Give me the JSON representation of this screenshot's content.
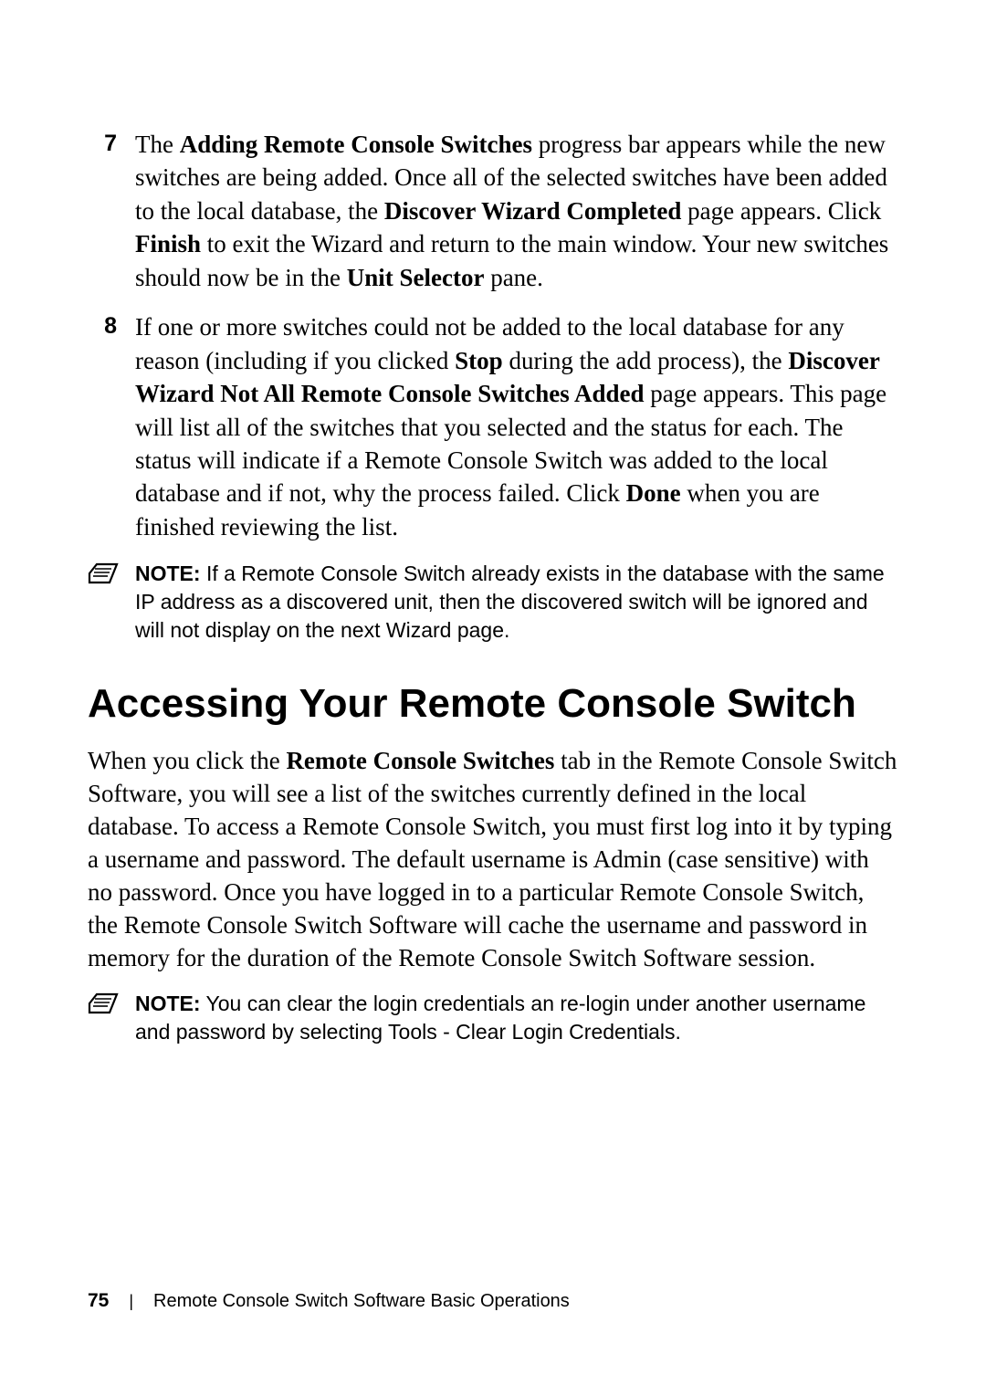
{
  "list": {
    "item7": {
      "num": "7",
      "text_a": "The ",
      "bold_a": "Adding Remote Console Switches",
      "text_b": " progress bar appears while the new switches are being added. Once all of the selected switches have been added to the local database, the ",
      "bold_b": "Discover Wizard Completed",
      "text_c": " page appears. Click ",
      "bold_c": "Finish",
      "text_d": " to exit the Wizard and return to the main window. Your new switches should now be in the ",
      "bold_d": "Unit Selector",
      "text_e": " pane."
    },
    "item8": {
      "num": "8",
      "text_a": "If one or more switches could not be added to the local database for any reason (including if you clicked ",
      "bold_a": "Stop",
      "text_b": " during the add process), the ",
      "bold_b": "Discover Wizard Not All Remote Console Switches Added",
      "text_c": " page appears. This page will list all of the switches that you selected and the status for each. The status will indicate if a Remote Console Switch was added to the local database and if not, why the process failed. Click ",
      "bold_c": "Done",
      "text_d": " when you are finished reviewing the list."
    }
  },
  "note1": {
    "label": "NOTE:",
    "text": " If a Remote Console Switch already exists in the database with the same IP address as a discovered unit, then the discovered switch will be ignored and will not display on the next Wizard page."
  },
  "heading": "Accessing Your Remote Console Switch",
  "para": {
    "text_a": "When you click the ",
    "bold_a": "Remote Console Switches",
    "text_b": " tab in the Remote Console Switch Software, you will see a list of the switches currently defined in the local database. To access a Remote Console Switch, you must first log into it by typing a username and password. The default username is Admin (case sensitive) with no password. Once you have logged in to a particular Remote Console Switch, the Remote Console Switch Software will cache the username and password in memory for the duration of the Remote Console Switch Software session."
  },
  "note2": {
    "label": "NOTE:",
    "text": " You can clear the login credentials an re-login under another username and password by selecting Tools - Clear Login Credentials."
  },
  "footer": {
    "page": "75",
    "sep": "|",
    "chapter": "Remote Console Switch Software Basic Operations"
  }
}
